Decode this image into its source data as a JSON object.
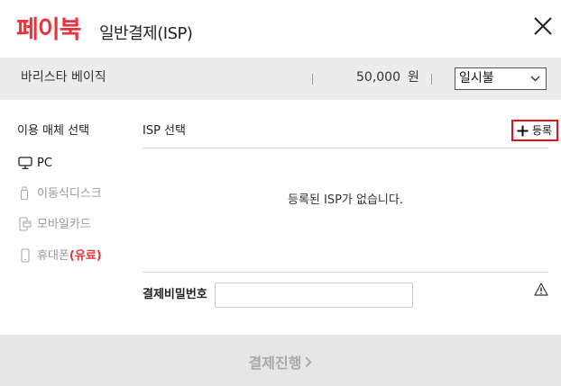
{
  "header": {
    "brand": "페이북",
    "title": "일반결제(ISP)"
  },
  "product": {
    "name": "바리스타 베이직",
    "amount": "50,000",
    "currency": "원",
    "installment_selected": "일시불"
  },
  "media": {
    "title": "이용 매체 선택",
    "items": [
      {
        "label": "PC",
        "icon": "monitor-icon",
        "active": true
      },
      {
        "label": "이동식디스크",
        "icon": "usb-icon",
        "active": false
      },
      {
        "label": "모바일카드",
        "icon": "mobile-card-icon",
        "active": false
      },
      {
        "label": "휴대폰",
        "paid_label": "(유료)",
        "icon": "phone-icon",
        "active": false
      }
    ]
  },
  "isp": {
    "title": "ISP 선택",
    "register_label": "등록",
    "empty_message": "등록된 ISP가 없습니다.",
    "password_label": "결제비밀번호",
    "password_value": ""
  },
  "footer": {
    "submit_label": "결제진행"
  },
  "colors": {
    "brand": "#e8333a",
    "highlight_border": "#e0121a",
    "bar_bg": "#ececec",
    "footer_bg": "#e6e6e6"
  }
}
